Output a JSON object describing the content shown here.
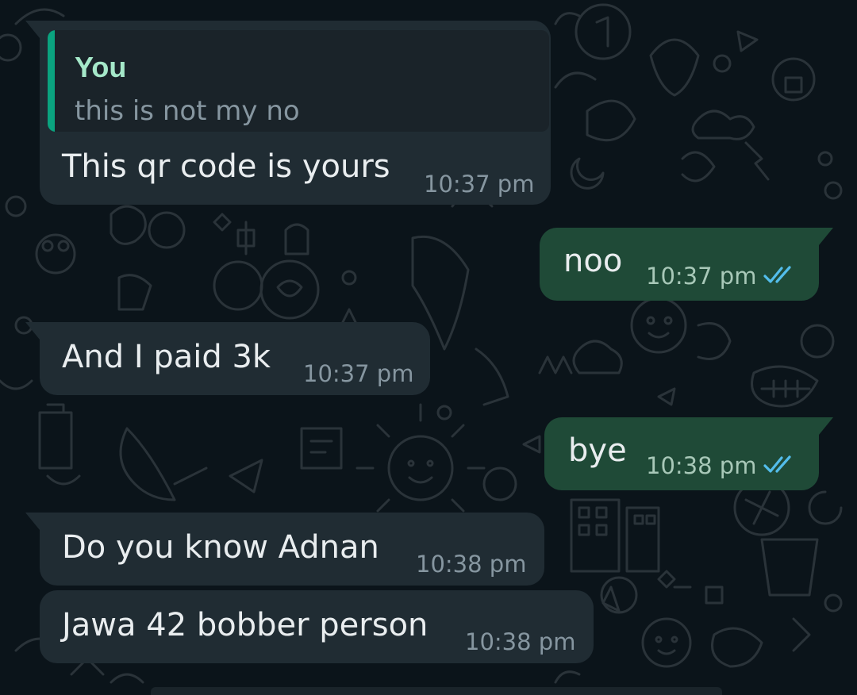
{
  "chat": {
    "messages": [
      {
        "direction": "incoming",
        "quote": {
          "author": "You",
          "text": "this is not my no"
        },
        "text": "This qr code is yours",
        "time": "10:37 pm"
      },
      {
        "direction": "outgoing",
        "text": "noo",
        "time": "10:37 pm",
        "status": "read",
        "status_icon": "double-check-icon"
      },
      {
        "direction": "incoming",
        "text": "And I paid 3k",
        "time": "10:37 pm"
      },
      {
        "direction": "outgoing",
        "text": "bye",
        "time": "10:38 pm",
        "status": "read",
        "status_icon": "double-check-icon"
      },
      {
        "direction": "incoming",
        "text": "Do you know Adnan",
        "time": "10:38 pm"
      },
      {
        "direction": "incoming",
        "text": "Jawa 42 bobber person",
        "time": "10:38 pm"
      }
    ]
  },
  "colors": {
    "background": "#0b141a",
    "incoming_bubble": "#202c33",
    "outgoing_bubble": "#1f4a37",
    "quote_accent": "#06cf9c",
    "read_tick": "#53bdeb",
    "text_primary": "#e9edef",
    "text_secondary": "#8696a0"
  }
}
